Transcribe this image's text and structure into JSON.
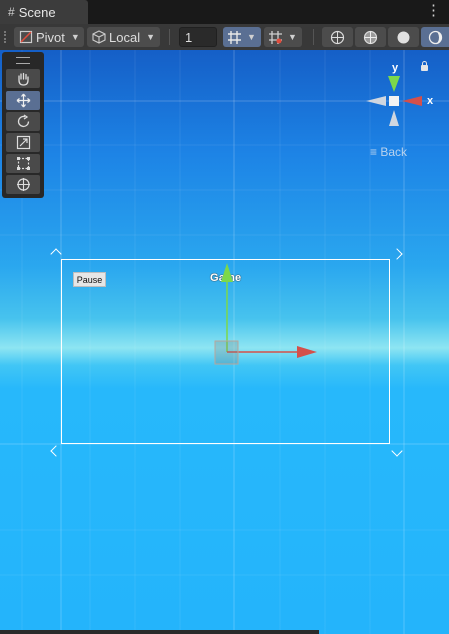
{
  "tab": {
    "icon": "grid-icon",
    "label": "Scene"
  },
  "toolbar": {
    "pivot_label": "Pivot",
    "local_label": "Local",
    "grid_size_value": "1",
    "icons": [
      "pivot-icon",
      "local-cube-icon",
      "grid-snap-icon",
      "snap-increment-icon",
      "wireframe-shading-icon",
      "shaded-wireframe-icon",
      "shaded-icon",
      "lighting-icon"
    ]
  },
  "tools": [
    "hand-tool-icon",
    "move-tool-icon",
    "rotate-tool-icon",
    "scale-tool-icon",
    "rect-tool-icon",
    "transform-tool-icon"
  ],
  "orientation_gizmo": {
    "y_label": "y",
    "x_label": "x",
    "back_label": "Back"
  },
  "scene": {
    "pause_label": "Pause",
    "game_title": "Game"
  },
  "colors": {
    "x_axis": "#d4504b",
    "y_axis": "#7cd84b",
    "selection": "#5a6f93"
  }
}
